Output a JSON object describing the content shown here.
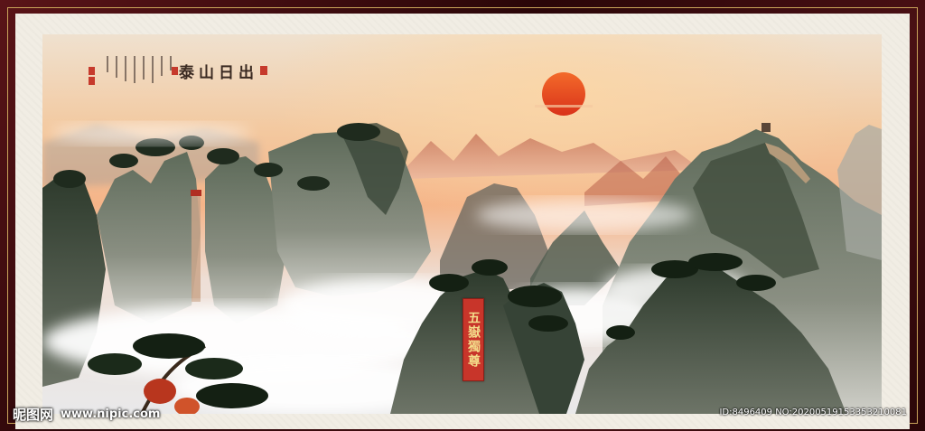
{
  "painting": {
    "title": "泰山日出",
    "banner_text": "五嶽獨尊",
    "colors": {
      "frame": "#4a1014",
      "mat": "#f1ede4",
      "sun": "#e8431f",
      "sky_warm": "#f2b483",
      "banner": "#c8352a"
    }
  },
  "watermark": {
    "site_name": "昵图网",
    "site_url": "www.nipic.com",
    "id_text": "ID:8496409 NO:20200519153353210081"
  }
}
